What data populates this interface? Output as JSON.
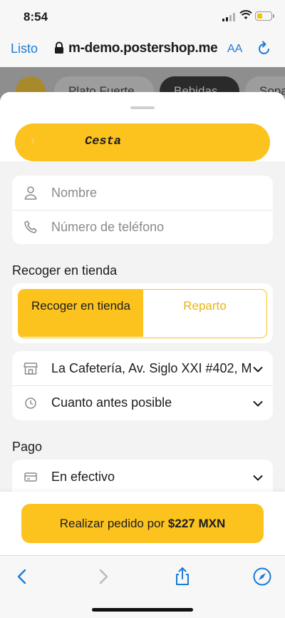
{
  "status": {
    "time": "8:54"
  },
  "browser": {
    "done_label": "Listo",
    "url": "m-demo.postershop.me",
    "text_size_label": "AA"
  },
  "background_menu": {
    "items": [
      "Plato Fuerte",
      "Bebidas",
      "Sopas"
    ]
  },
  "sheet": {
    "basket_label": "Cesta",
    "contact": {
      "name_placeholder": "Nombre",
      "phone_placeholder": "Número de teléfono"
    },
    "delivery_section_title": "Recoger en tienda",
    "delivery_options": {
      "pickup": "Recoger en tienda",
      "delivery": "Reparto",
      "selected": "pickup"
    },
    "location": "La Cafetería, Av. Siglo XXI #402, M",
    "time_option": "Cuanto antes posible",
    "payment_section_title": "Pago",
    "payment_method": "En efectivo"
  },
  "order": {
    "label": "Realizar pedido por",
    "amount": "$227 MXN"
  },
  "colors": {
    "accent": "#fcc31e",
    "link": "#1b7bd6"
  },
  "battery_level": 0.4
}
